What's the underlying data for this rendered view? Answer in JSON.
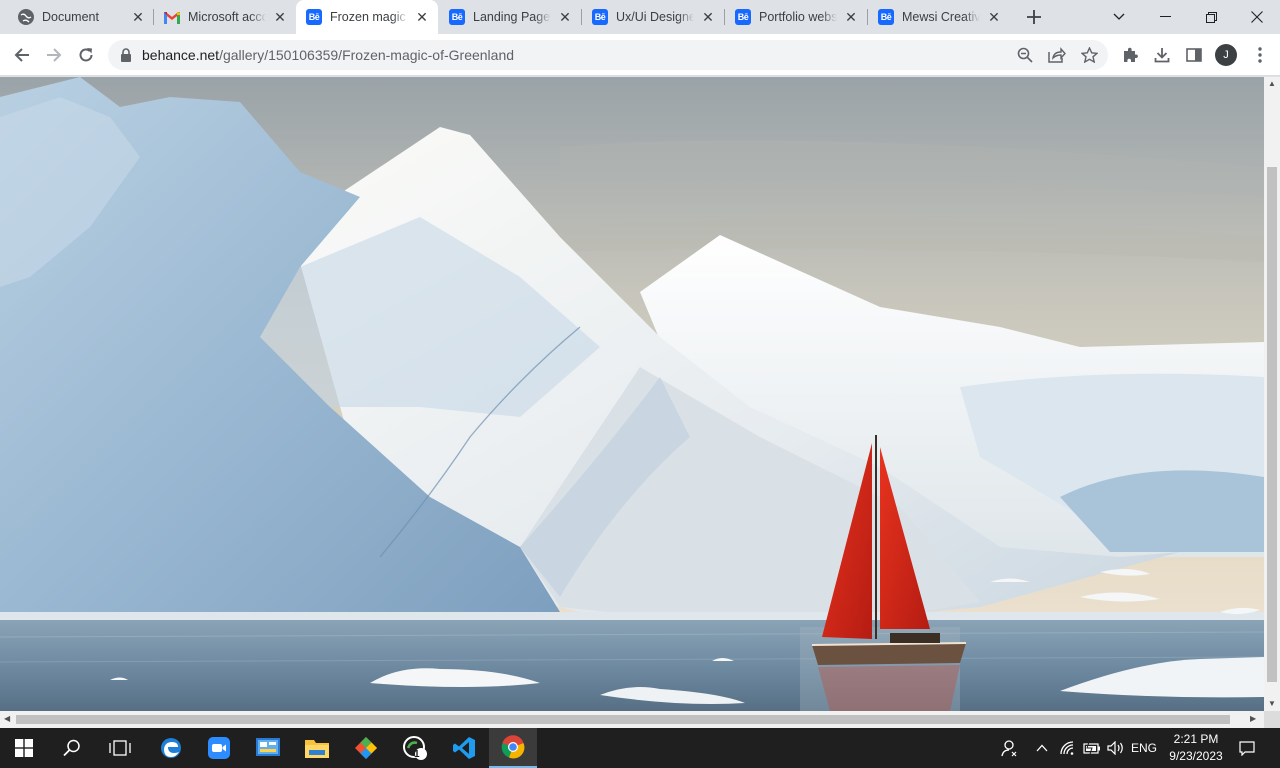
{
  "tabs": [
    {
      "title": "Document",
      "favicon": "globe-icon"
    },
    {
      "title": "Microsoft account",
      "favicon": "gmail-icon"
    },
    {
      "title": "Frozen magic of Greenland",
      "favicon": "behance-icon",
      "active": true
    },
    {
      "title": "Landing Page - UI",
      "favicon": "behance-icon"
    },
    {
      "title": "Ux/Ui Designer",
      "favicon": "behance-icon"
    },
    {
      "title": "Portfolio website",
      "favicon": "behance-icon"
    },
    {
      "title": "Mewsi Creative",
      "favicon": "behance-icon"
    }
  ],
  "behance_glyph": "Bē",
  "address_bar": {
    "domain": "behance.net",
    "path": "/gallery/150106359/Frozen-magic-of-Greenland"
  },
  "profile_initial": "J",
  "taskbar": {
    "apps": [
      "windows-start-icon",
      "search-icon",
      "task-view-icon",
      "edge-icon",
      "zoom-icon",
      "control-panel-icon",
      "file-explorer-icon",
      "git-icon",
      "app-notification-icon",
      "vscode-icon",
      "chrome-icon"
    ],
    "notification_badge": "1",
    "language": "ENG",
    "time": "2:21 PM",
    "date": "9/23/2023"
  },
  "colors": {
    "behance_blue": "#1769ff",
    "tabstrip_bg": "#dee1e6",
    "taskbar_bg": "#1f1f1f",
    "sail_red": "#d5281b"
  }
}
